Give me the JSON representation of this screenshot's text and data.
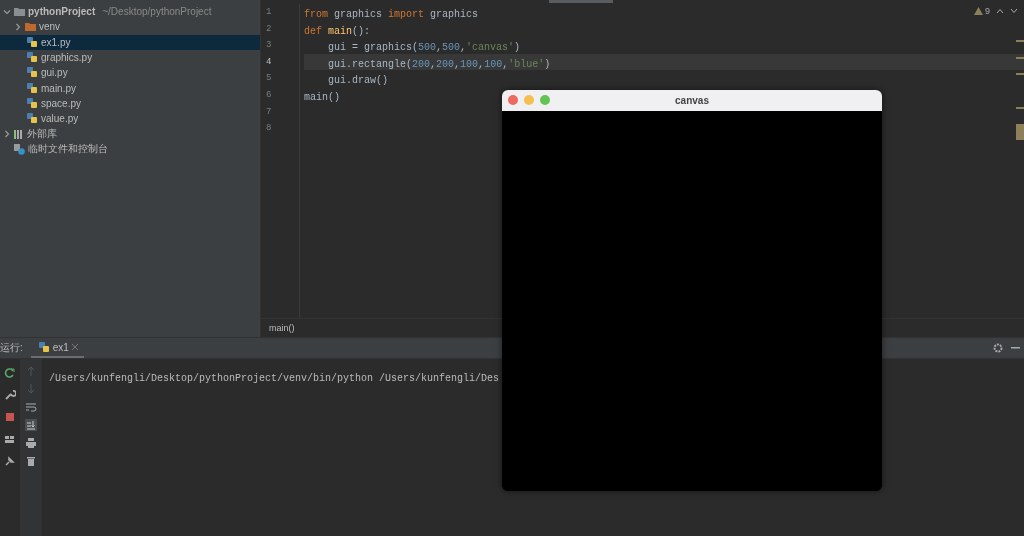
{
  "project_tree": {
    "root": {
      "name": "pythonProject",
      "path": "~/Desktop/pythonProject",
      "expanded": true
    },
    "items": [
      {
        "kind": "folder",
        "name": "venv",
        "expanded": false,
        "selected": false
      },
      {
        "kind": "file",
        "name": "ex1.py",
        "selected": true
      },
      {
        "kind": "file",
        "name": "graphics.py",
        "selected": false
      },
      {
        "kind": "file",
        "name": "gui.py",
        "selected": false
      },
      {
        "kind": "file",
        "name": "main.py",
        "selected": false
      },
      {
        "kind": "file",
        "name": "space.py",
        "selected": false
      },
      {
        "kind": "file",
        "name": "value.py",
        "selected": false
      }
    ],
    "extras": [
      {
        "kind": "library",
        "name": "外部库",
        "expanded": false
      },
      {
        "kind": "scratches",
        "name": "临时文件和控制台"
      }
    ]
  },
  "editor": {
    "warnings": "9",
    "lines": [
      {
        "number": "1",
        "current": false,
        "tokens": [
          {
            "kind": "keyword",
            "text": "from"
          },
          {
            "kind": "plain",
            "text": " graphics "
          },
          {
            "kind": "keyword",
            "text": "import"
          },
          {
            "kind": "plain",
            "text": " graphics"
          }
        ]
      },
      {
        "number": "2",
        "current": false,
        "tokens": [
          {
            "kind": "keyword",
            "text": "def "
          },
          {
            "kind": "function",
            "text": "main"
          },
          {
            "kind": "plain",
            "text": "():"
          }
        ]
      },
      {
        "number": "3",
        "current": false,
        "tokens": [
          {
            "kind": "plain",
            "text": "    gui = graphics("
          },
          {
            "kind": "number",
            "text": "500"
          },
          {
            "kind": "plain",
            "text": ","
          },
          {
            "kind": "number",
            "text": "500"
          },
          {
            "kind": "plain",
            "text": ","
          },
          {
            "kind": "string",
            "text": "'canvas'"
          },
          {
            "kind": "plain",
            "text": ")"
          }
        ]
      },
      {
        "number": "4",
        "current": true,
        "tokens": [
          {
            "kind": "plain",
            "text": "    gui.rectangle("
          },
          {
            "kind": "number",
            "text": "200"
          },
          {
            "kind": "plain",
            "text": ","
          },
          {
            "kind": "number",
            "text": "200"
          },
          {
            "kind": "plain",
            "text": ","
          },
          {
            "kind": "number",
            "text": "100"
          },
          {
            "kind": "plain",
            "text": ","
          },
          {
            "kind": "number",
            "text": "100"
          },
          {
            "kind": "plain",
            "text": ","
          },
          {
            "kind": "string",
            "text": "'blue'"
          },
          {
            "kind": "plain",
            "text": ")"
          }
        ]
      },
      {
        "number": "5",
        "current": false,
        "tokens": [
          {
            "kind": "plain",
            "text": "    gui.draw()"
          }
        ]
      },
      {
        "number": "6",
        "current": false,
        "tokens": [
          {
            "kind": "plain",
            "text": "main()"
          }
        ]
      },
      {
        "number": "7",
        "current": false
      },
      {
        "number": "8",
        "current": false
      }
    ],
    "breadcrumb": "main()"
  },
  "run_panel": {
    "label": "运行:",
    "tabs": [
      {
        "label": "ex1",
        "selected": true
      }
    ],
    "output": "/Users/kunfengli/Desktop/pythonProject/venv/bin/python /Users/kunfengli/Des"
  },
  "canvas_window": {
    "title": "canvas"
  }
}
